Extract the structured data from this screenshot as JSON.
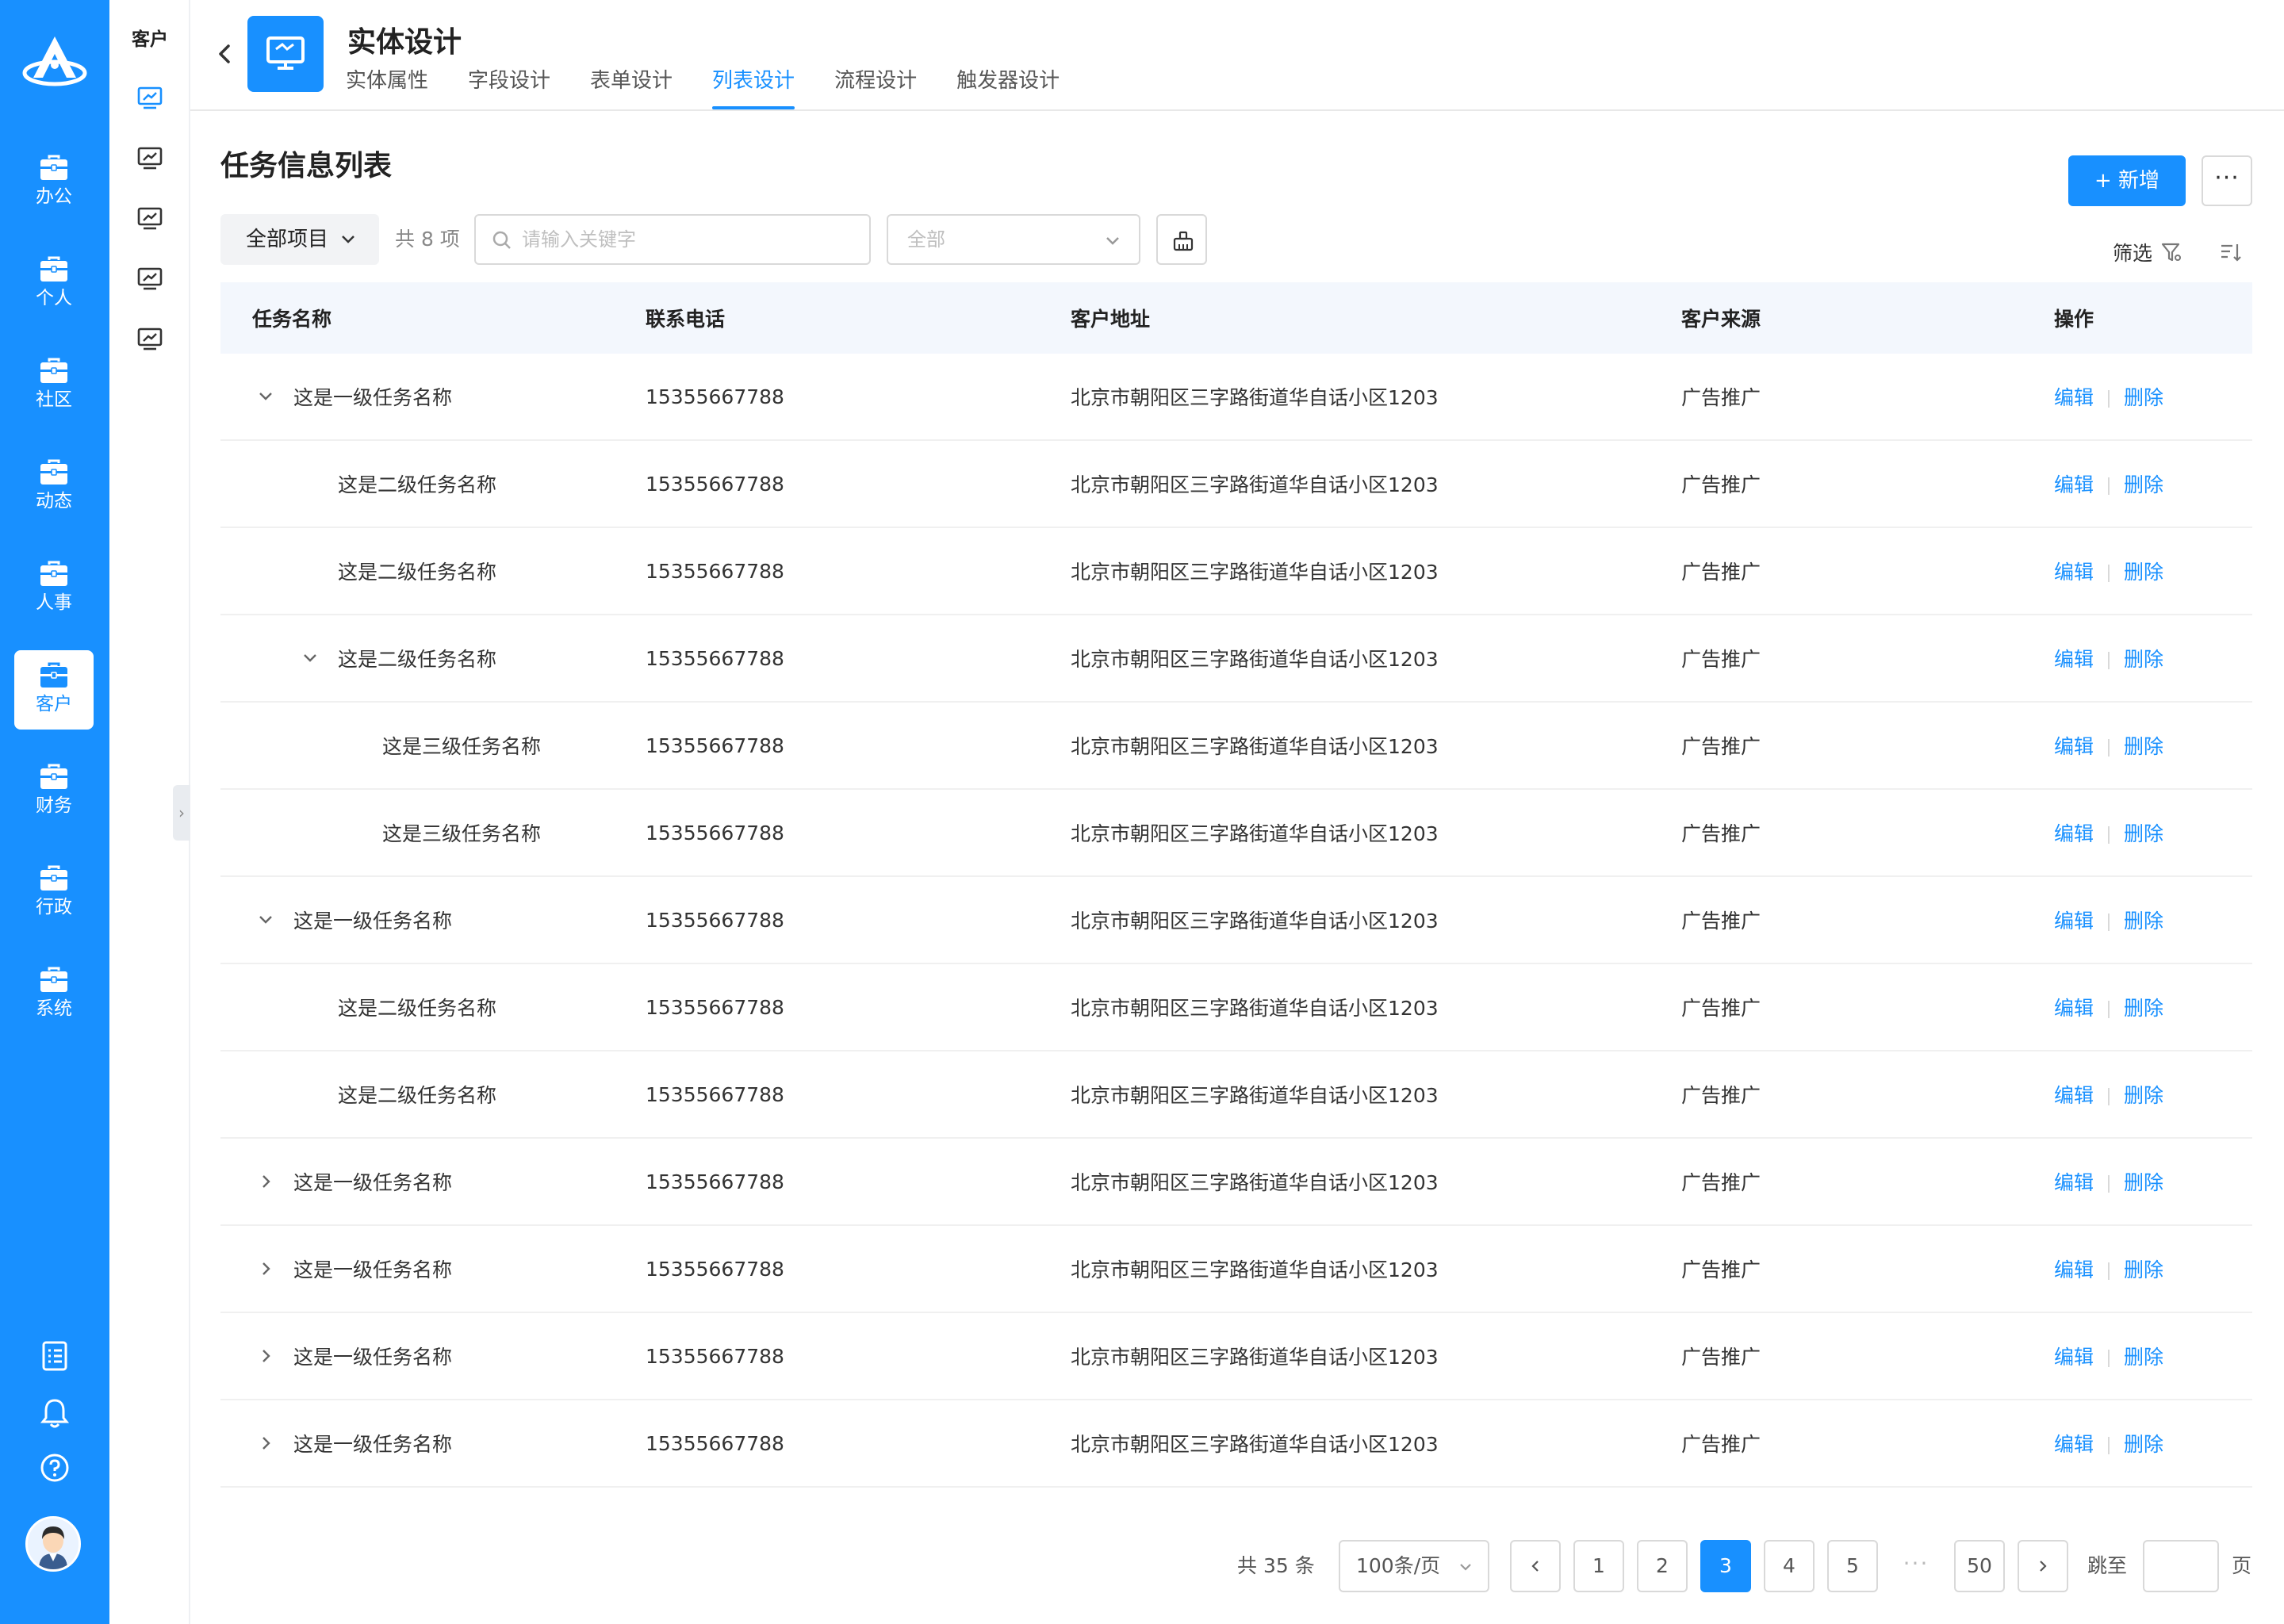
{
  "nav": {
    "items": [
      {
        "label": "办公",
        "active": false
      },
      {
        "label": "个人",
        "active": false
      },
      {
        "label": "社区",
        "active": false
      },
      {
        "label": "动态",
        "active": false
      },
      {
        "label": "人事",
        "active": false
      },
      {
        "label": "客户",
        "active": true
      },
      {
        "label": "财务",
        "active": false
      },
      {
        "label": "行政",
        "active": false
      },
      {
        "label": "系统",
        "active": false
      }
    ],
    "bottom_icons": [
      "task-list-icon",
      "bell-icon",
      "help-icon"
    ]
  },
  "subnav": {
    "title": "客户",
    "icon": "chart-monitor-icon"
  },
  "header": {
    "title": "实体设计",
    "tabs": [
      {
        "label": "实体属性",
        "active": false
      },
      {
        "label": "字段设计",
        "active": false
      },
      {
        "label": "表单设计",
        "active": false
      },
      {
        "label": "列表设计",
        "active": true
      },
      {
        "label": "流程设计",
        "active": false
      },
      {
        "label": "触发器设计",
        "active": false
      }
    ]
  },
  "main": {
    "title": "任务信息列表",
    "add_label": "+ 新增",
    "more_label": "···",
    "project_select": "全部项目",
    "count_text": "共 8 项",
    "search_placeholder": "请输入关键字",
    "status_select_placeholder": "全部",
    "filter_label": "筛选"
  },
  "table": {
    "columns": [
      "任务名称",
      "联系电话",
      "客户地址",
      "客户来源",
      "操作"
    ],
    "edit_label": "编辑",
    "delete_label": "删除",
    "rows": [
      {
        "name": "这是一级任务名称",
        "level": 1,
        "toggle": "expanded",
        "phone": "15355667788",
        "address": "北京市朝阳区三字路街道华自话小区1203",
        "source": "广告推广"
      },
      {
        "name": "这是二级任务名称",
        "level": 2,
        "toggle": "none",
        "phone": "15355667788",
        "address": "北京市朝阳区三字路街道华自话小区1203",
        "source": "广告推广"
      },
      {
        "name": "这是二级任务名称",
        "level": 2,
        "toggle": "none",
        "phone": "15355667788",
        "address": "北京市朝阳区三字路街道华自话小区1203",
        "source": "广告推广"
      },
      {
        "name": "这是二级任务名称",
        "level": 2,
        "toggle": "expanded",
        "phone": "15355667788",
        "address": "北京市朝阳区三字路街道华自话小区1203",
        "source": "广告推广"
      },
      {
        "name": "这是三级任务名称",
        "level": 3,
        "toggle": "none",
        "phone": "15355667788",
        "address": "北京市朝阳区三字路街道华自话小区1203",
        "source": "广告推广"
      },
      {
        "name": "这是三级任务名称",
        "level": 3,
        "toggle": "none",
        "phone": "15355667788",
        "address": "北京市朝阳区三字路街道华自话小区1203",
        "source": "广告推广"
      },
      {
        "name": "这是一级任务名称",
        "level": 1,
        "toggle": "expanded",
        "phone": "15355667788",
        "address": "北京市朝阳区三字路街道华自话小区1203",
        "source": "广告推广"
      },
      {
        "name": "这是二级任务名称",
        "level": 2,
        "toggle": "none",
        "phone": "15355667788",
        "address": "北京市朝阳区三字路街道华自话小区1203",
        "source": "广告推广"
      },
      {
        "name": "这是二级任务名称",
        "level": 2,
        "toggle": "none",
        "phone": "15355667788",
        "address": "北京市朝阳区三字路街道华自话小区1203",
        "source": "广告推广"
      },
      {
        "name": "这是一级任务名称",
        "level": 1,
        "toggle": "collapsed",
        "phone": "15355667788",
        "address": "北京市朝阳区三字路街道华自话小区1203",
        "source": "广告推广"
      },
      {
        "name": "这是一级任务名称",
        "level": 1,
        "toggle": "collapsed",
        "phone": "15355667788",
        "address": "北京市朝阳区三字路街道华自话小区1203",
        "source": "广告推广"
      },
      {
        "name": "这是一级任务名称",
        "level": 1,
        "toggle": "collapsed",
        "phone": "15355667788",
        "address": "北京市朝阳区三字路街道华自话小区1203",
        "source": "广告推广"
      },
      {
        "name": "这是一级任务名称",
        "level": 1,
        "toggle": "collapsed",
        "phone": "15355667788",
        "address": "北京市朝阳区三字路街道华自话小区1203",
        "source": "广告推广"
      }
    ]
  },
  "pagination": {
    "total_text": "共 35 条",
    "page_size": "100条/页",
    "pages": [
      "1",
      "2",
      "3",
      "4",
      "5"
    ],
    "current": "3",
    "ellipsis": "···",
    "last": "50",
    "jump_label": "跳至",
    "page_label": "页"
  },
  "colors": {
    "primary": "#1890ff",
    "header_row_bg": "#f3f7fd"
  }
}
